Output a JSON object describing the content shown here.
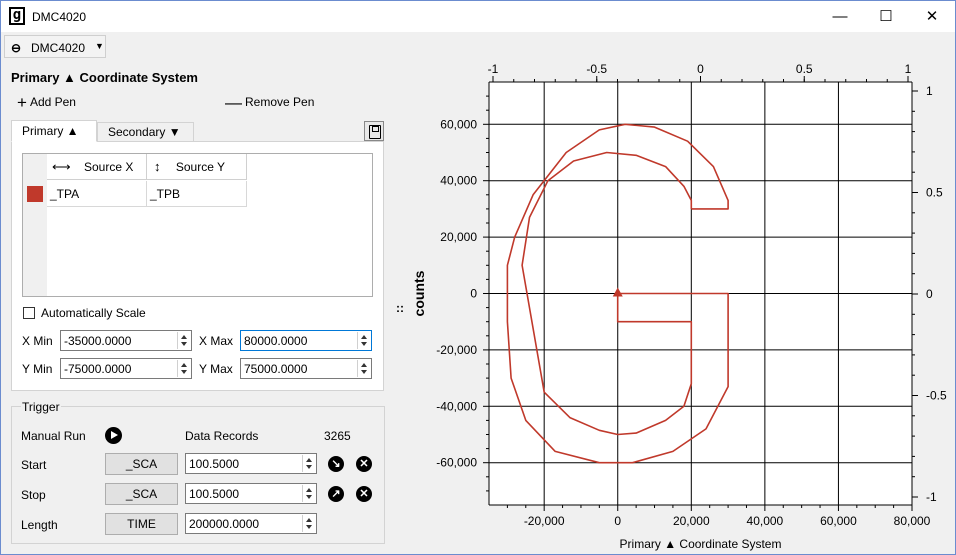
{
  "window": {
    "title": "DMC4020",
    "controls": {
      "minimize": "—",
      "maximize": "☐",
      "close": "✕"
    }
  },
  "toolbar": {
    "device_label": "DMC4020",
    "device_icon": "link-icon",
    "dropdown_icon": "▾"
  },
  "panel": {
    "title": "Primary ▲ Coordinate System",
    "add_pen": "Add Pen",
    "remove_pen": "Remove Pen",
    "tabs": [
      {
        "label": "Primary ▲"
      },
      {
        "label": "Secondary ▼"
      }
    ],
    "table": {
      "headers": {
        "x": "Source X",
        "y": "Source Y"
      },
      "rows": [
        {
          "color": "#c0392b",
          "x": "_TPA",
          "y": "_TPB"
        }
      ]
    },
    "auto_scale_label": "Automatically Scale",
    "auto_scale_checked": false,
    "limits": {
      "xmin_label": "X Min",
      "xmin": "-35000.0000",
      "xmax_label": "X Max",
      "xmax": "80000.0000",
      "ymin_label": "Y Min",
      "ymin": "-75000.0000",
      "ymax_label": "Y Max",
      "ymax": "75000.0000"
    }
  },
  "trigger": {
    "title": "Trigger",
    "manual_run": "Manual Run",
    "data_records_label": "Data Records",
    "data_records_value": "3265",
    "start": {
      "label": "Start",
      "source": "_SCA",
      "value": "100.5000"
    },
    "stop": {
      "label": "Stop",
      "source": "_SCA",
      "value": "100.5000"
    },
    "length": {
      "label": "Length",
      "source": "TIME",
      "value": "200000.0000"
    }
  },
  "chart_data": {
    "type": "line",
    "title": "",
    "xlabel": "Primary ▲ Coordinate System",
    "ylabel": "counts",
    "xlim": [
      -35000,
      80000
    ],
    "ylim": [
      -75000,
      75000
    ],
    "x_ticks": [
      -20000,
      0,
      20000,
      40000,
      60000,
      80000
    ],
    "x_tick_labels": [
      "-20,000",
      "0",
      "20,000",
      "40,000",
      "60,000",
      "80,000"
    ],
    "y_ticks": [
      60000,
      40000,
      20000,
      0,
      -20000,
      -40000,
      -60000
    ],
    "y_tick_labels": [
      "60,000",
      "40,000",
      "20,000",
      "0",
      "-20,000",
      "-40,000",
      "-60,000"
    ],
    "top_ticks": [
      "-1",
      "-0.5",
      "0",
      "0.5",
      "1"
    ],
    "right_ticks": [
      "1",
      "0.5",
      "0",
      "-0.5",
      "-1"
    ],
    "grid": true,
    "series": [
      {
        "color": "#c0392b",
        "points": [
          [
            20000,
            30000
          ],
          [
            20000,
            33000
          ],
          [
            18000,
            38000
          ],
          [
            13000,
            45000
          ],
          [
            5000,
            49000
          ],
          [
            -3000,
            50000
          ],
          [
            -12000,
            47000
          ],
          [
            -19000,
            40000
          ],
          [
            -24000,
            27000
          ],
          [
            -26000,
            10000
          ],
          [
            -20000,
            -35000
          ],
          [
            -13000,
            -44000
          ],
          [
            -5000,
            -48500
          ],
          [
            0,
            -50000
          ],
          [
            5000,
            -49500
          ],
          [
            13000,
            -45000
          ],
          [
            18000,
            -40000
          ],
          [
            20000,
            -32000
          ],
          [
            20000,
            -10000
          ],
          [
            0,
            -10000
          ],
          [
            0,
            0
          ],
          [
            30000,
            0
          ],
          [
            30000,
            -33000
          ],
          [
            24000,
            -48000
          ],
          [
            15000,
            -56000
          ],
          [
            4000,
            -60000
          ],
          [
            -5000,
            -60000
          ],
          [
            -17000,
            -56000
          ],
          [
            -25000,
            -45000
          ],
          [
            -29000,
            -30000
          ],
          [
            -30000,
            -10000
          ],
          [
            -30000,
            10000
          ],
          [
            -28000,
            20000
          ],
          [
            -23000,
            35000
          ],
          [
            -14000,
            50000
          ],
          [
            -5000,
            58000
          ],
          [
            2000,
            60000
          ],
          [
            10000,
            59000
          ],
          [
            19000,
            54000
          ],
          [
            26000,
            45000
          ],
          [
            30000,
            33000
          ],
          [
            30000,
            30000
          ],
          [
            20000,
            30000
          ]
        ]
      }
    ],
    "marker": [
      0,
      0
    ]
  }
}
